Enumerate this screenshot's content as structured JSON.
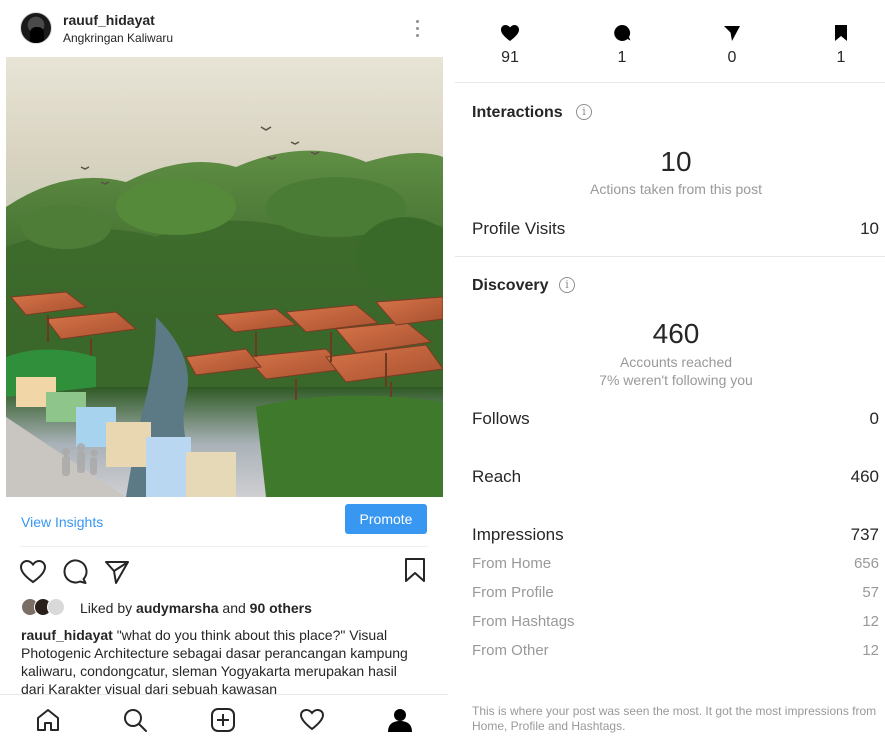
{
  "post": {
    "username": "rauuf_hidayat",
    "location": "Angkringan Kaliwaru",
    "view_insights": "View Insights",
    "promote": "Promote",
    "liked_by_prefix": "Liked by",
    "liked_by_user": "audymarsha",
    "liked_by_and": "and",
    "liked_by_others": "90 others",
    "caption_user": "rauuf_hidayat",
    "caption_text": "\"what do you think about this place?\" Visual Photogenic Architecture sebagai dasar perancangan kampung kaliwaru, condongcatur, sleman Yogyakarta merupakan hasil dari Karakter visual dari sebuah kawasan"
  },
  "icons": {
    "more": "more-vertical-icon",
    "like": "heart-icon",
    "comment": "comment-icon",
    "share": "send-icon",
    "save": "bookmark-icon",
    "nav": [
      "home-icon",
      "search-icon",
      "add-post-icon",
      "activity-heart-icon",
      "profile-icon"
    ]
  },
  "insights": {
    "stats": [
      {
        "icon": "heart-icon",
        "value": "91"
      },
      {
        "icon": "comment-icon",
        "value": "1"
      },
      {
        "icon": "send-icon",
        "value": "0"
      },
      {
        "icon": "bookmark-icon",
        "value": "1"
      }
    ],
    "interactions": {
      "title": "Interactions",
      "count": "10",
      "subtitle": "Actions taken from this post",
      "profile_visits_label": "Profile Visits",
      "profile_visits_value": "10"
    },
    "discovery": {
      "title": "Discovery",
      "count": "460",
      "subtitle1": "Accounts reached",
      "subtitle2": "7% weren't following you",
      "follows_label": "Follows",
      "follows_value": "0",
      "reach_label": "Reach",
      "reach_value": "460",
      "impressions_label": "Impressions",
      "impressions_value": "737",
      "breakdown": [
        {
          "label": "From Home",
          "value": "656"
        },
        {
          "label": "From Profile",
          "value": "57"
        },
        {
          "label": "From Hashtags",
          "value": "12"
        },
        {
          "label": "From Other",
          "value": "12"
        }
      ]
    },
    "footnote": "This is where your post was seen the most. It got the most impressions from Home, Profile and Hashtags."
  },
  "colors": {
    "accent": "#3897f0",
    "text": "#262626",
    "muted": "#999999"
  }
}
